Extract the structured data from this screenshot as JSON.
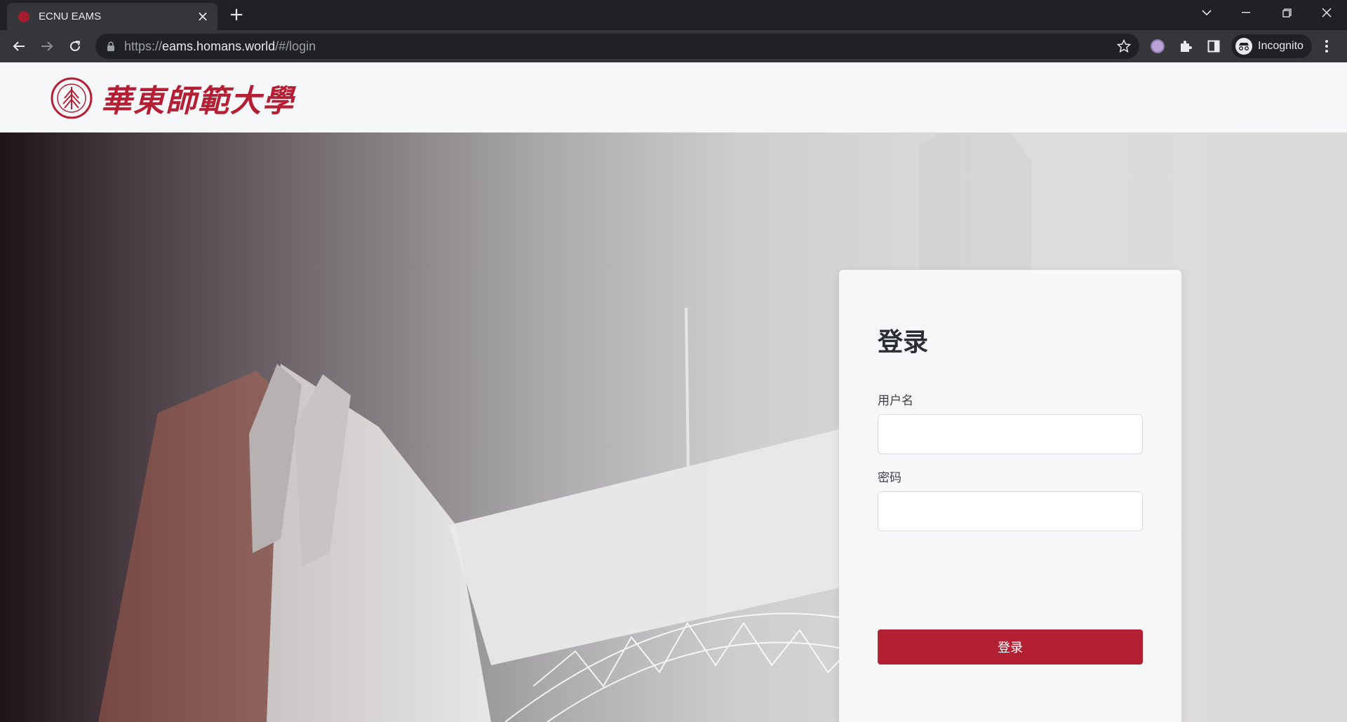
{
  "browser": {
    "tab_title": "ECNU EAMS",
    "url_scheme": "https://",
    "url_host": "eams.homans.world",
    "url_path": "/#/login",
    "profile_label": "Incognito"
  },
  "header": {
    "logo_text": "華東師範大學"
  },
  "login": {
    "title": "登录",
    "username_label": "用户名",
    "username_value": "",
    "password_label": "密码",
    "password_value": "",
    "submit_label": "登录"
  },
  "colors": {
    "brand": "#b31f33",
    "card_bg": "#f6f7f9",
    "chrome_dark": "#202124"
  }
}
